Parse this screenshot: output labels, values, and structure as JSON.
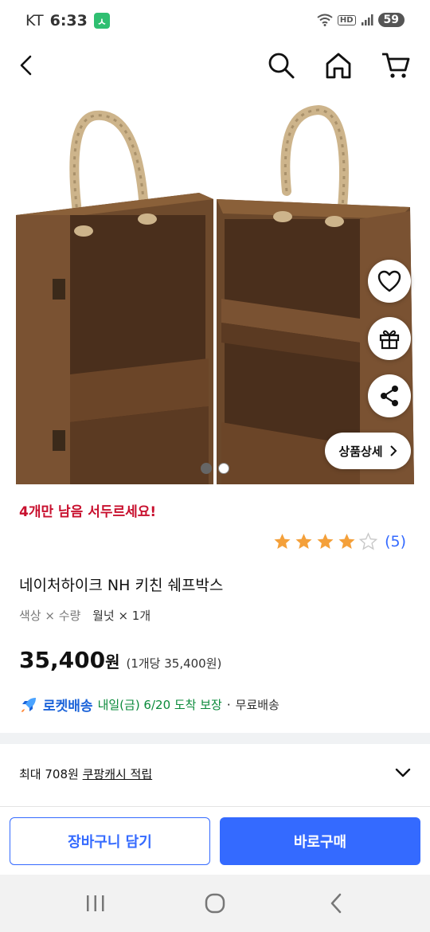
{
  "status_bar": {
    "carrier": "KT",
    "time": "6:33",
    "app_badge": "ㅅ",
    "network": "HD",
    "battery": "59"
  },
  "top_bar": {
    "icons": [
      "back-icon",
      "search-icon",
      "home-icon",
      "cart-icon"
    ]
  },
  "gallery": {
    "image_count": 2,
    "current_index": 1,
    "detail_button_label": "상품상세",
    "actions": [
      "heart-icon",
      "gift-icon",
      "share-icon"
    ]
  },
  "product": {
    "stock_alert": "4개만 남음 서두르세요!",
    "rating": {
      "stars": 4,
      "max": 5,
      "count_label": "(5)"
    },
    "title": "네이처하이크 NH 키친 쉐프박스",
    "option_key": "색상 × 수량",
    "option_value": "월넛 × 1개",
    "price": "35,400",
    "price_unit": "원",
    "unit_price": "(1개당 35,400원)",
    "delivery": {
      "label": "로켓배송",
      "arrival": "내일(금) 6/20 도착 보장",
      "separator": "·",
      "free": "무료배송"
    }
  },
  "cash": {
    "prefix": "최대 708원",
    "link": "쿠팡캐시 적립"
  },
  "actions": {
    "cart_label": "장바구니 담기",
    "buy_label": "바로구매"
  },
  "colors": {
    "accent": "#346aff",
    "alert": "#c8102e",
    "arrival": "#0a8a3a",
    "star": "#f4a03a"
  }
}
